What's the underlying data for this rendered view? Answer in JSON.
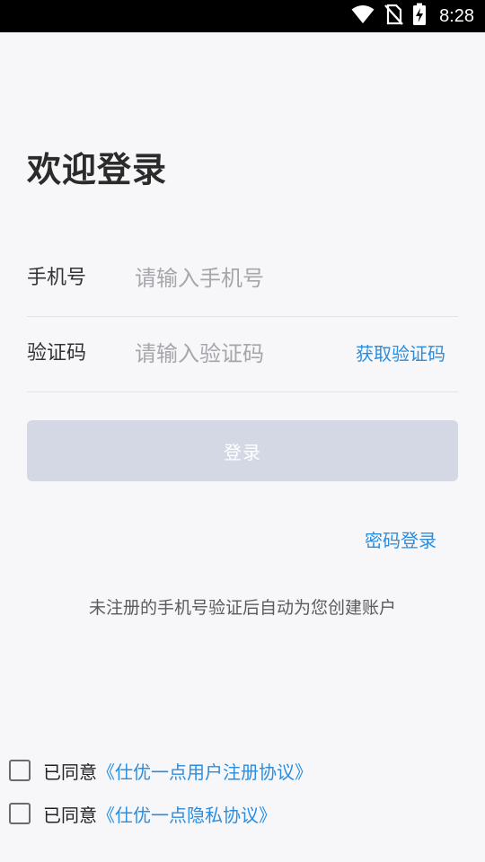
{
  "status_bar": {
    "time": "8:28",
    "icons": [
      "wifi-icon",
      "no-sim-icon",
      "battery-charging-icon"
    ]
  },
  "title": "欢迎登录",
  "phone": {
    "label": "手机号",
    "placeholder": "请输入手机号",
    "value": ""
  },
  "code": {
    "label": "验证码",
    "placeholder": "请输入验证码",
    "value": "",
    "get_code_label": "获取验证码"
  },
  "login_button": {
    "label": "登录",
    "state": "disabled"
  },
  "password_login_label": "密码登录",
  "hint": "未注册的手机号验证后自动为您创建账户",
  "agreements": [
    {
      "prefix": "已同意",
      "link": "《仕优一点用户注册协议》",
      "checked": false
    },
    {
      "prefix": "已同意",
      "link": "《仕优一点隐私协议》",
      "checked": false
    }
  ],
  "colors": {
    "background": "#f7f7f9",
    "accent": "#2a8ee0",
    "button_disabled": "#d3d8e4",
    "divider": "#e2e3e8"
  }
}
